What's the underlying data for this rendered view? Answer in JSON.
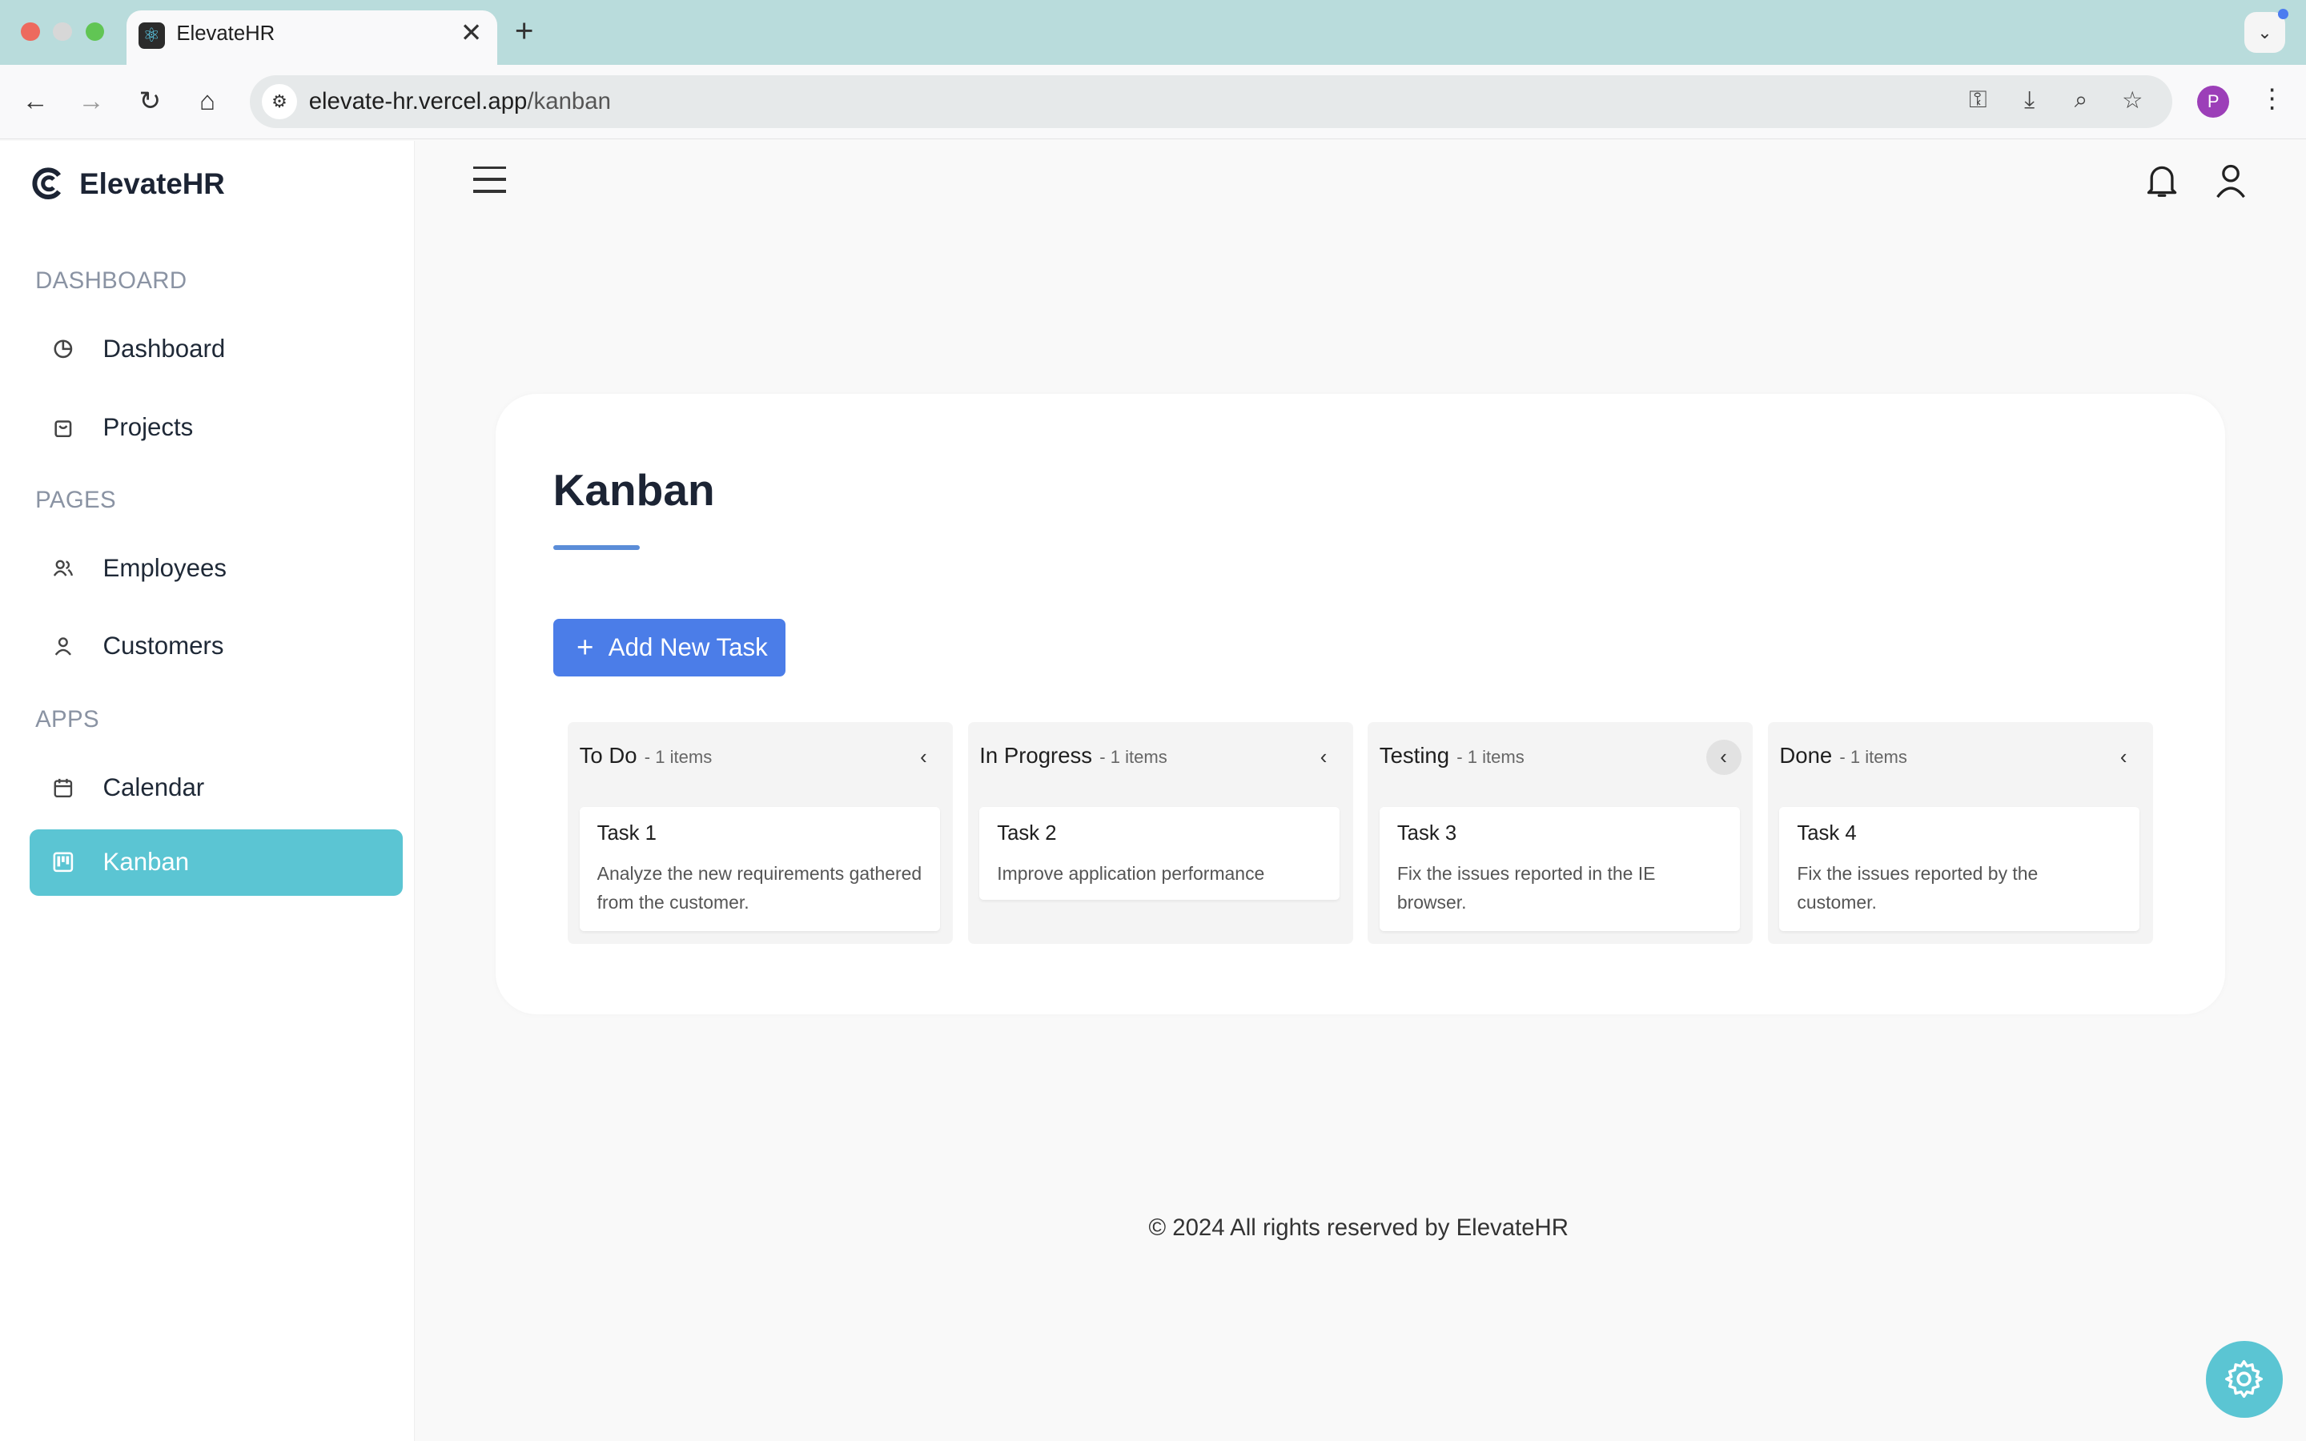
{
  "browser": {
    "tab_title": "ElevateHR",
    "tab_close": "✕",
    "new_tab": "+",
    "url_host": "elevate-hr.vercel.app",
    "url_path": "/kanban",
    "profile_initial": "P",
    "traffic_colors": [
      "#ed6a5e",
      "#d7d7d7",
      "#61c554"
    ]
  },
  "sidebar": {
    "brand": "ElevateHR",
    "sections": {
      "dashboard": "DASHBOARD",
      "pages": "PAGES",
      "apps": "APPS"
    },
    "items": [
      {
        "label": "Dashboard",
        "icon": "pie-chart-icon"
      },
      {
        "label": "Projects",
        "icon": "shopping-bag-icon"
      },
      {
        "label": "Employees",
        "icon": "users-icon"
      },
      {
        "label": "Customers",
        "icon": "user-icon"
      },
      {
        "label": "Calendar",
        "icon": "calendar-icon"
      },
      {
        "label": "Kanban",
        "icon": "kanban-icon",
        "active": true
      }
    ],
    "active_color": "#5bc5d3"
  },
  "page": {
    "title": "Kanban",
    "add_button": "Add New Task",
    "accent_color": "#4b7de8"
  },
  "columns": [
    {
      "name": "To Do",
      "count": "- 1 items",
      "task": {
        "title": "Task 1",
        "desc": "Analyze the new requirements gathered from the customer."
      }
    },
    {
      "name": "In Progress",
      "count": "- 1 items",
      "task": {
        "title": "Task 2",
        "desc": "Improve application performance"
      }
    },
    {
      "name": "Testing",
      "count": "- 1 items",
      "task": {
        "title": "Task 3",
        "desc": "Fix the issues reported in the IE browser."
      }
    },
    {
      "name": "Done",
      "count": "- 1 items",
      "task": {
        "title": "Task 4",
        "desc": "Fix the issues reported by the customer."
      }
    }
  ],
  "footer": "© 2024 All rights reserved by ElevateHR"
}
